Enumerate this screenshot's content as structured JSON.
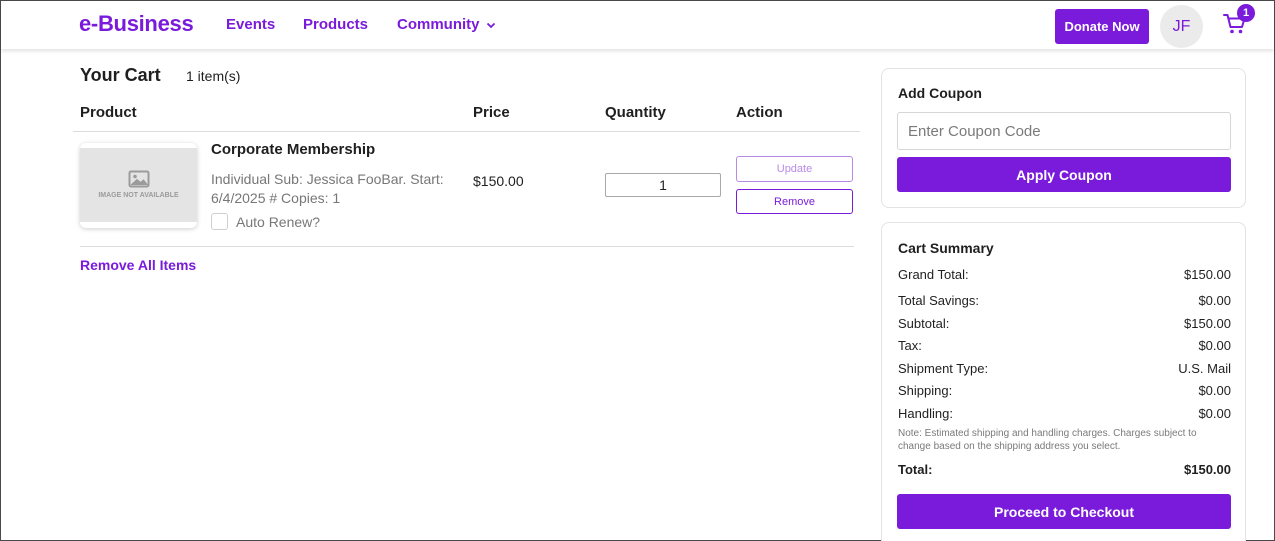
{
  "header": {
    "logo": "e-Business",
    "nav": [
      "Events",
      "Products",
      "Community"
    ],
    "donate_label": "Donate Now",
    "avatar_initials": "JF",
    "cart_badge": "1"
  },
  "cart": {
    "title": "Your Cart",
    "count": "1 item(s)",
    "columns": [
      "Product",
      "Price",
      "Quantity",
      "Action"
    ],
    "items": [
      {
        "thumb_text": "IMAGE NOT AVAILABLE",
        "name": "Corporate Membership",
        "description": "Individual Sub: Jessica FooBar. Start: 6/4/2025 # Copies: 1",
        "auto_renew_label": "Auto Renew?",
        "price": "$150.00",
        "quantity": "1",
        "update_label": "Update",
        "remove_label": "Remove"
      }
    ],
    "remove_all_label": "Remove All Items"
  },
  "coupon": {
    "title": "Add Coupon",
    "placeholder": "Enter Coupon Code",
    "apply_label": "Apply Coupon"
  },
  "summary": {
    "title": "Cart Summary",
    "rows": [
      {
        "label": "Grand Total:",
        "value": "$150.00"
      },
      {
        "label": "Total Savings:",
        "value": "$0.00"
      },
      {
        "label": "Subtotal:",
        "value": "$150.00"
      },
      {
        "label": "Tax:",
        "value": "$0.00"
      },
      {
        "label": "Shipment Type:",
        "value": "U.S. Mail"
      },
      {
        "label": "Shipping:",
        "value": "$0.00"
      },
      {
        "label": "Handling:",
        "value": "$0.00"
      }
    ],
    "note": "Note: Estimated shipping and handling charges. Charges subject to change based on the shipping address you select.",
    "total_label": "Total:",
    "total_value": "$150.00",
    "checkout_label": "Proceed to Checkout"
  },
  "colors": {
    "brand": "#7a1bdb",
    "text": "#1f1f1f",
    "muted": "#777777"
  }
}
